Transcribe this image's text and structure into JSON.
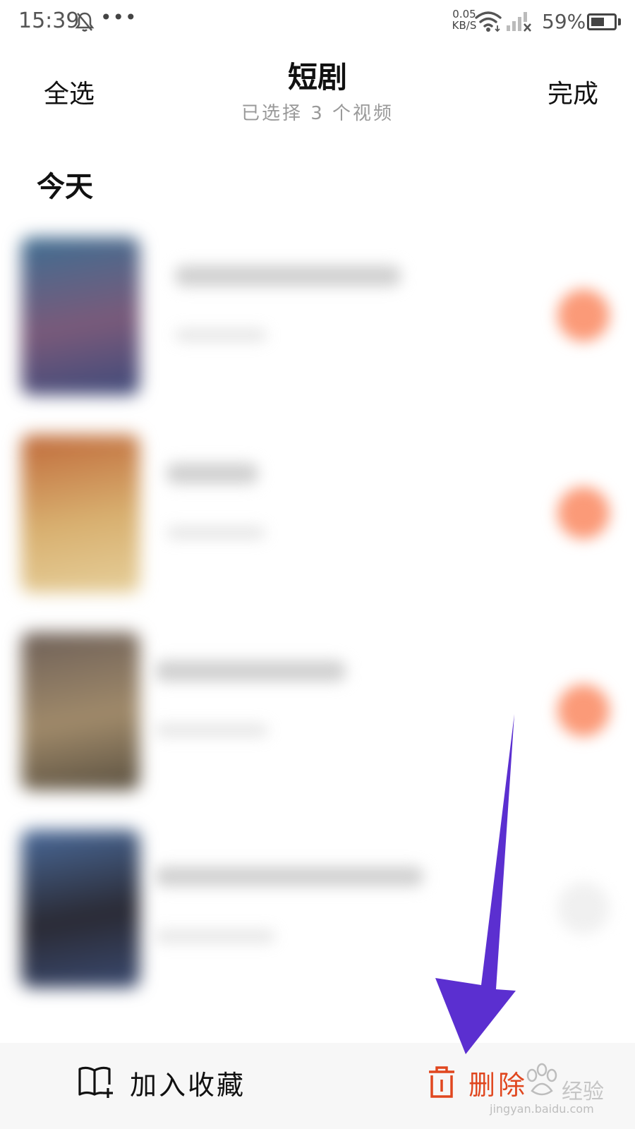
{
  "status_bar": {
    "time": "15:39",
    "dots": "•••",
    "net_speed_value": "0.05",
    "net_speed_unit": "KB/S",
    "battery_percent": "59%",
    "battery_level": 0.59,
    "icons": [
      "bell-off-icon",
      "wifi-icon",
      "signal-icon",
      "battery-icon"
    ]
  },
  "header": {
    "select_all_label": "全选",
    "title": "短剧",
    "subtitle": "已选择 3 个视频",
    "done_label": "完成"
  },
  "section": {
    "label": "今天"
  },
  "list": {
    "items": [
      {
        "thumb_colors": [
          "#3e6e92",
          "#7a5a7a",
          "#3e4a7a"
        ],
        "selected": true
      },
      {
        "thumb_colors": [
          "#c06a3a",
          "#d8b070",
          "#e6cf9a"
        ],
        "selected": true
      },
      {
        "thumb_colors": [
          "#6e6058",
          "#a08a6a",
          "#5a5040"
        ],
        "selected": true
      },
      {
        "thumb_colors": [
          "#4a6a9a",
          "#2a2a34",
          "#3a4a70"
        ],
        "selected": false
      }
    ]
  },
  "bottom_bar": {
    "favorite_label": "加入收藏",
    "favorite_icon": "book-add-icon",
    "delete_label": "删除",
    "delete_icon": "trash-icon"
  },
  "annotation": {
    "arrow_color": "#5b2fd0"
  },
  "watermark": {
    "brand": "经验",
    "url": "jingyan.baidu.com"
  },
  "colors": {
    "accent": "#e0471f",
    "check_selected": "#fb9a78",
    "check_unselected": "#f0f0f0",
    "bottom_bar_bg": "#f7f7f7"
  }
}
